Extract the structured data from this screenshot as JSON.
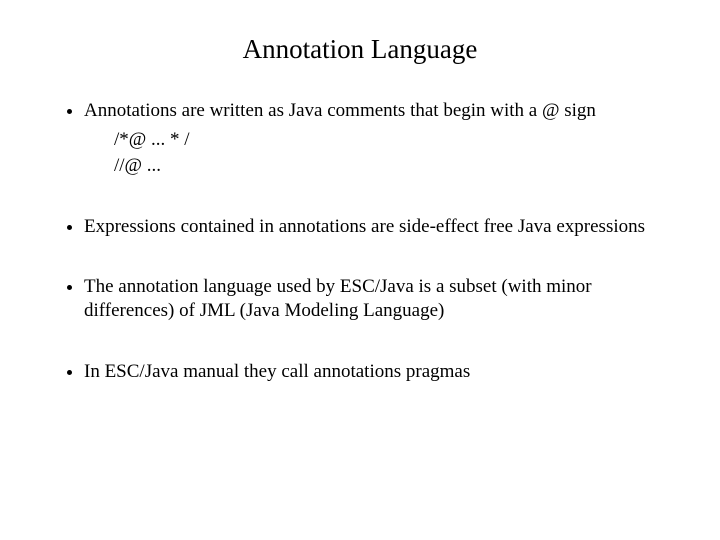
{
  "title": "Annotation Language",
  "bullet1": {
    "main": "Annotations are written  as Java comments that begin with a @ sign",
    "line1": "/*@  ... * /",
    "line2": "//@ ..."
  },
  "bullet2": "Expressions contained in annotations are side-effect free Java expressions",
  "bullet3": "The annotation language used by ESC/Java is a subset (with minor differences) of JML (Java Modeling Language)",
  "bullet4": "In ESC/Java manual they call annotations pragmas"
}
